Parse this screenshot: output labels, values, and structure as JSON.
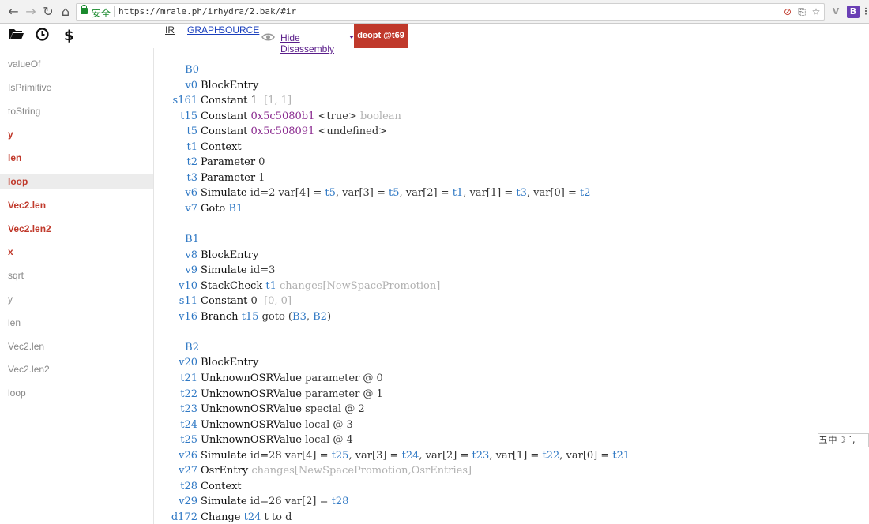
{
  "browser": {
    "secure_label": "安全",
    "url": "https://mrale.ph/irhydra/2.bak/#ir",
    "back_icon": "←",
    "forward_icon": "→",
    "reload_icon": "↻",
    "home_icon": "⌂",
    "star_icon": "☆",
    "ext_b_label": "B",
    "ext_v_label": "V"
  },
  "toolbar": {
    "open_icon": "▰",
    "clock_icon": "◷",
    "dollar_label": "$",
    "tab_ir": "IR",
    "tab_graph": "GRAPH",
    "tab_source": "SOURCE",
    "hide_label": "Hide Disassembly",
    "deopt_label": "deopt @t69"
  },
  "sidebar": [
    {
      "label": "valueOf",
      "hot": false,
      "sel": false
    },
    {
      "label": "IsPrimitive",
      "hot": false,
      "sel": false
    },
    {
      "label": "toString",
      "hot": false,
      "sel": false
    },
    {
      "label": "y",
      "hot": true,
      "sel": false
    },
    {
      "label": "len",
      "hot": true,
      "sel": false
    },
    {
      "label": "loop",
      "hot": true,
      "sel": true
    },
    {
      "label": "Vec2.len",
      "hot": true,
      "sel": false
    },
    {
      "label": "Vec2.len2",
      "hot": true,
      "sel": false
    },
    {
      "label": "x",
      "hot": true,
      "sel": false
    },
    {
      "label": "sqrt",
      "hot": false,
      "sel": false
    },
    {
      "label": "y",
      "hot": false,
      "sel": false
    },
    {
      "label": "len",
      "hot": false,
      "sel": false
    },
    {
      "label": "Vec2.len",
      "hot": false,
      "sel": false
    },
    {
      "label": "Vec2.len2",
      "hot": false,
      "sel": false
    },
    {
      "label": "loop",
      "hot": false,
      "sel": false
    }
  ],
  "code_lines": [
    {
      "id": "B0",
      "block": true,
      "parts": []
    },
    {
      "id": "v0",
      "parts": [
        {
          "t": "BlockEntry",
          "c": "op"
        }
      ]
    },
    {
      "id": "s161",
      "parts": [
        {
          "t": "Constant",
          "c": "op"
        },
        {
          "t": " 1  ",
          "c": "arg"
        },
        {
          "t": "[1, 1]",
          "c": "dim"
        }
      ]
    },
    {
      "id": "t15",
      "parts": [
        {
          "t": "Constant",
          "c": "op"
        },
        {
          "t": " ",
          "c": "arg"
        },
        {
          "t": "0x5c5080b1",
          "c": "hex"
        },
        {
          "t": " <true> ",
          "c": "arg"
        },
        {
          "t": "boolean",
          "c": "dim"
        }
      ]
    },
    {
      "id": "t5",
      "parts": [
        {
          "t": "Constant",
          "c": "op"
        },
        {
          "t": " ",
          "c": "arg"
        },
        {
          "t": "0x5c508091",
          "c": "hex"
        },
        {
          "t": " <undefined>",
          "c": "arg"
        }
      ]
    },
    {
      "id": "t1",
      "parts": [
        {
          "t": "Context",
          "c": "op"
        }
      ]
    },
    {
      "id": "t2",
      "parts": [
        {
          "t": "Parameter",
          "c": "op"
        },
        {
          "t": " 0",
          "c": "arg"
        }
      ]
    },
    {
      "id": "t3",
      "parts": [
        {
          "t": "Parameter",
          "c": "op"
        },
        {
          "t": " 1",
          "c": "arg"
        }
      ]
    },
    {
      "id": "v6",
      "parts": [
        {
          "t": "Simulate",
          "c": "op"
        },
        {
          "t": " id=2 var[4] = ",
          "c": "arg"
        },
        {
          "t": "t5",
          "c": "ref"
        },
        {
          "t": ", var[3] = ",
          "c": "arg"
        },
        {
          "t": "t5",
          "c": "ref"
        },
        {
          "t": ", var[2] = ",
          "c": "arg"
        },
        {
          "t": "t1",
          "c": "ref"
        },
        {
          "t": ", var[1] = ",
          "c": "arg"
        },
        {
          "t": "t3",
          "c": "ref"
        },
        {
          "t": ", var[0] = ",
          "c": "arg"
        },
        {
          "t": "t2",
          "c": "ref"
        }
      ]
    },
    {
      "id": "v7",
      "parts": [
        {
          "t": "Goto",
          "c": "op"
        },
        {
          "t": " ",
          "c": "arg"
        },
        {
          "t": "B1",
          "c": "ref"
        }
      ]
    },
    {
      "id": "",
      "parts": []
    },
    {
      "id": "B1",
      "block": true,
      "parts": []
    },
    {
      "id": "v8",
      "parts": [
        {
          "t": "BlockEntry",
          "c": "op"
        }
      ]
    },
    {
      "id": "v9",
      "parts": [
        {
          "t": "Simulate",
          "c": "op"
        },
        {
          "t": " id=3",
          "c": "arg"
        }
      ]
    },
    {
      "id": "v10",
      "parts": [
        {
          "t": "StackCheck",
          "c": "op"
        },
        {
          "t": " ",
          "c": "arg"
        },
        {
          "t": "t1",
          "c": "ref"
        },
        {
          "t": " changes[NewSpacePromotion]",
          "c": "dim"
        }
      ]
    },
    {
      "id": "s11",
      "parts": [
        {
          "t": "Constant",
          "c": "op"
        },
        {
          "t": " 0  ",
          "c": "arg"
        },
        {
          "t": "[0, 0]",
          "c": "dim"
        }
      ]
    },
    {
      "id": "v16",
      "parts": [
        {
          "t": "Branch",
          "c": "op"
        },
        {
          "t": " ",
          "c": "arg"
        },
        {
          "t": "t15",
          "c": "ref"
        },
        {
          "t": " goto (",
          "c": "arg"
        },
        {
          "t": "B3",
          "c": "ref"
        },
        {
          "t": ", ",
          "c": "arg"
        },
        {
          "t": "B2",
          "c": "ref"
        },
        {
          "t": ")",
          "c": "arg"
        }
      ]
    },
    {
      "id": "",
      "parts": []
    },
    {
      "id": "B2",
      "block": true,
      "parts": []
    },
    {
      "id": "v20",
      "parts": [
        {
          "t": "BlockEntry",
          "c": "op"
        }
      ]
    },
    {
      "id": "t21",
      "parts": [
        {
          "t": "UnknownOSRValue",
          "c": "op"
        },
        {
          "t": " parameter @ 0",
          "c": "arg"
        }
      ]
    },
    {
      "id": "t22",
      "parts": [
        {
          "t": "UnknownOSRValue",
          "c": "op"
        },
        {
          "t": " parameter @ 1",
          "c": "arg"
        }
      ]
    },
    {
      "id": "t23",
      "parts": [
        {
          "t": "UnknownOSRValue",
          "c": "op"
        },
        {
          "t": " special @ 2",
          "c": "arg"
        }
      ]
    },
    {
      "id": "t24",
      "parts": [
        {
          "t": "UnknownOSRValue",
          "c": "op"
        },
        {
          "t": " local @ 3",
          "c": "arg"
        }
      ]
    },
    {
      "id": "t25",
      "parts": [
        {
          "t": "UnknownOSRValue",
          "c": "op"
        },
        {
          "t": " local @ 4",
          "c": "arg"
        }
      ]
    },
    {
      "id": "v26",
      "parts": [
        {
          "t": "Simulate",
          "c": "op"
        },
        {
          "t": " id=28 var[4] = ",
          "c": "arg"
        },
        {
          "t": "t25",
          "c": "ref"
        },
        {
          "t": ", var[3] = ",
          "c": "arg"
        },
        {
          "t": "t24",
          "c": "ref"
        },
        {
          "t": ", var[2] = ",
          "c": "arg"
        },
        {
          "t": "t23",
          "c": "ref"
        },
        {
          "t": ", var[1] = ",
          "c": "arg"
        },
        {
          "t": "t22",
          "c": "ref"
        },
        {
          "t": ", var[0] = ",
          "c": "arg"
        },
        {
          "t": "t21",
          "c": "ref"
        }
      ]
    },
    {
      "id": "v27",
      "parts": [
        {
          "t": "OsrEntry",
          "c": "op"
        },
        {
          "t": " changes[NewSpacePromotion,OsrEntries]",
          "c": "dim"
        }
      ]
    },
    {
      "id": "t28",
      "parts": [
        {
          "t": "Context",
          "c": "op"
        }
      ]
    },
    {
      "id": "v29",
      "parts": [
        {
          "t": "Simulate",
          "c": "op"
        },
        {
          "t": " id=26 var[2] = ",
          "c": "arg"
        },
        {
          "t": "t28",
          "c": "ref"
        }
      ]
    },
    {
      "id": "d172",
      "parts": [
        {
          "t": "Change",
          "c": "op"
        },
        {
          "t": " ",
          "c": "arg"
        },
        {
          "t": "t24",
          "c": "ref"
        },
        {
          "t": " t to d",
          "c": "arg"
        }
      ]
    }
  ],
  "ime": [
    "五",
    "中",
    "☽",
    "˙,"
  ]
}
